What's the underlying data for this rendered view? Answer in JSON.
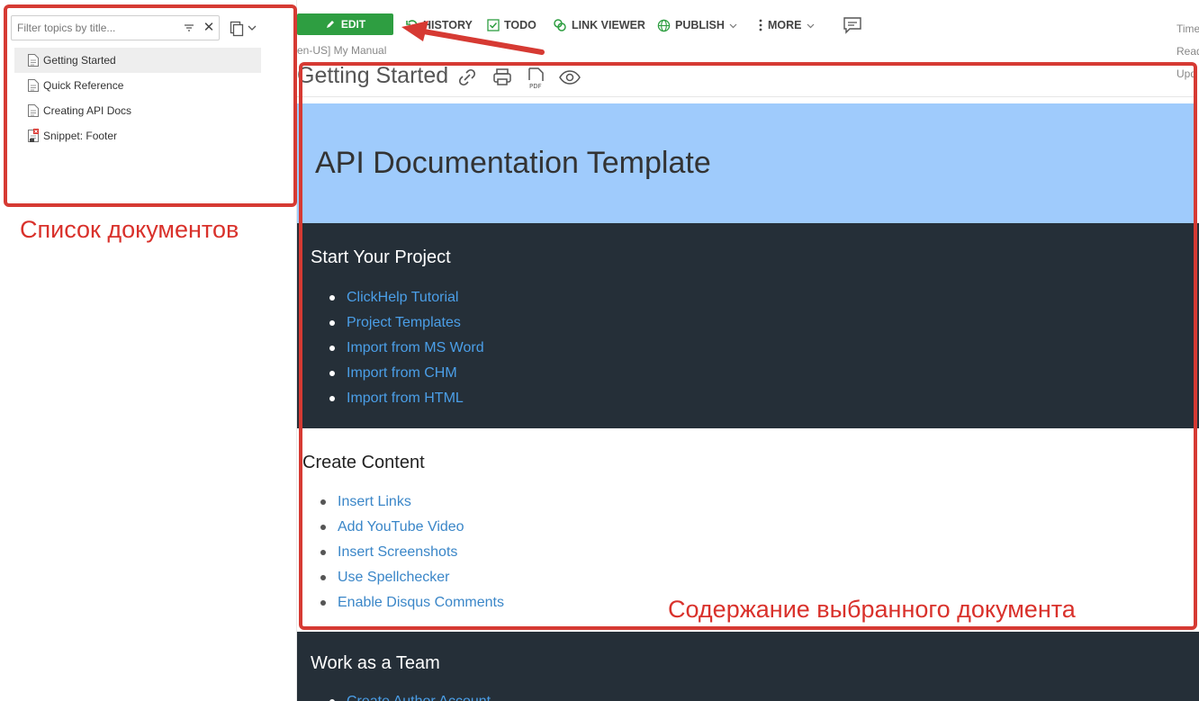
{
  "sidebar": {
    "filter_placeholder": "Filter topics by title...",
    "items": [
      {
        "label": "Getting Started",
        "selected": true
      },
      {
        "label": "Quick Reference",
        "selected": false
      },
      {
        "label": "Creating API Docs",
        "selected": false
      },
      {
        "label": "Snippet: Footer",
        "selected": false
      }
    ],
    "caption": "Список документов"
  },
  "toolbar": {
    "edit": "EDIT",
    "history": "HISTORY",
    "todo": "TODO",
    "link_viewer": "LINK VIEWER",
    "publish": "PUBLISH",
    "more": "MORE"
  },
  "breadcrumb": "en-US] My Manual",
  "right_labels": [
    "Time",
    "Read",
    "Upd"
  ],
  "page": {
    "title": "Getting Started",
    "hero_title": "API Documentation Template",
    "sections": [
      {
        "heading": "Start Your Project",
        "links": [
          "ClickHelp Tutorial",
          "Project Templates",
          "Import from MS Word",
          "Import from CHM",
          "Import from HTML"
        ]
      },
      {
        "heading": "Create Content",
        "links": [
          "Insert Links",
          "Add YouTube Video",
          "Insert Screenshots",
          "Use Spellchecker",
          "Enable Disqus Comments"
        ]
      },
      {
        "heading": "Work as a Team",
        "links": [
          "Create Author Account"
        ]
      }
    ],
    "caption": "Содержание выбранного документа"
  },
  "colors": {
    "edit_green": "#2e9e41",
    "hero_blue": "#9fcbfc",
    "dark_section": "#252f38",
    "annotation_red": "#d63a33"
  }
}
